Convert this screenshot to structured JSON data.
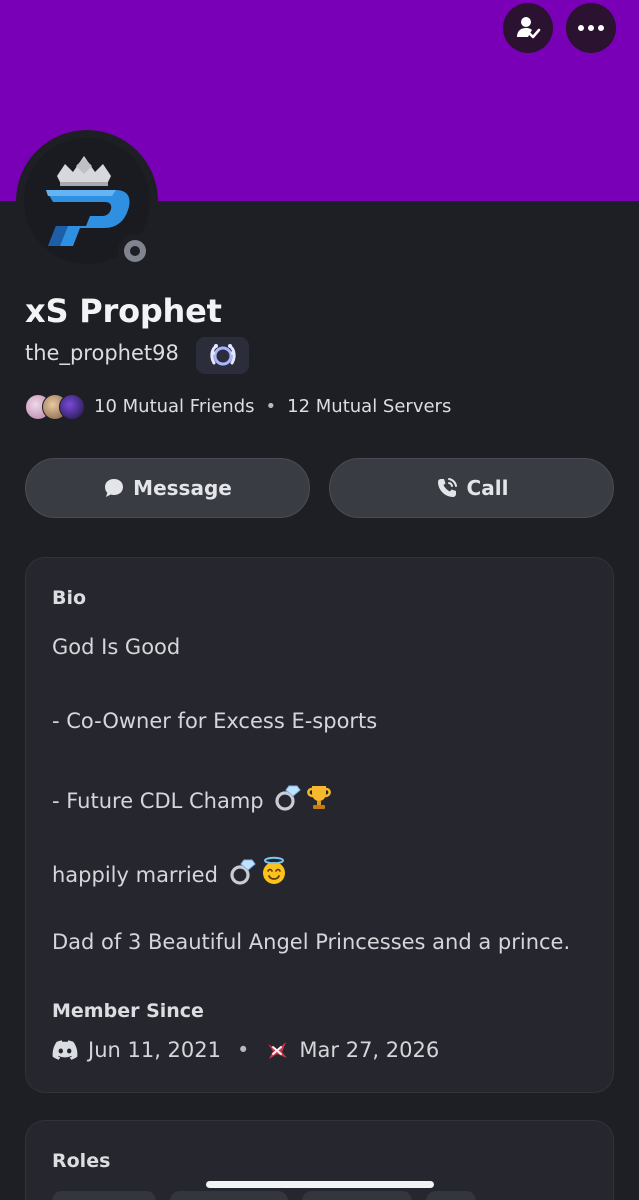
{
  "profile": {
    "display_name": "xS Prophet",
    "username": "the_prophet98",
    "status": "offline",
    "badge_icon": "laurel-wreath-icon",
    "banner_color": "#7a00b8"
  },
  "mutual": {
    "friends": "10 Mutual Friends",
    "servers": "12 Mutual Servers"
  },
  "actions": {
    "message_label": "Message",
    "call_label": "Call"
  },
  "bio": {
    "title": "Bio",
    "lines": [
      "God Is Good",
      "- Co-Owner for Excess E-sports",
      "- Future CDL Champ",
      "happily married",
      "Dad of 3 Beautiful Angel Princesses and a prince."
    ],
    "emojis": {
      "line3": [
        "ring-emoji",
        "trophy-emoji"
      ],
      "line4": [
        "ring-emoji",
        "angel-face-emoji"
      ]
    }
  },
  "member_since": {
    "title": "Member Since",
    "discord_date": "Jun 11, 2021",
    "server_date": "Mar 27, 2026",
    "separator": "•"
  },
  "roles": {
    "title": "Roles"
  },
  "separator": "•"
}
